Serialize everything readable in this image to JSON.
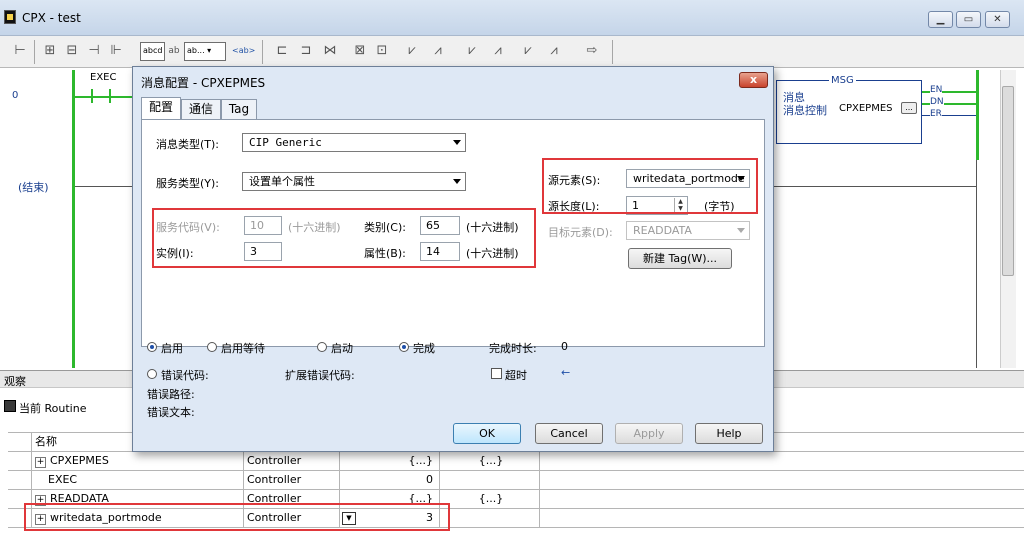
{
  "window": {
    "title": "CPX - test"
  },
  "toolbar": {
    "format_box_1": "abcd",
    "format_box_2": "ab...",
    "format_box_3": "<ab>"
  },
  "ladder": {
    "rung_number": "0",
    "end_label": "(结束)",
    "exec_label": "EXEC",
    "msg_block": {
      "header": "MSG",
      "line1": "消息",
      "line2": "消息控制",
      "control_tag": "CPXEPMES",
      "ellipsis": "...",
      "outputs": [
        "EN",
        "DN",
        "ER"
      ]
    }
  },
  "dialog": {
    "title": "消息配置 - CPXEPMES",
    "close": "x",
    "tabs": [
      "配置",
      "通信",
      "Tag"
    ],
    "message_type_label": "消息类型(T):",
    "message_type_value": "CIP Generic",
    "service_type_label": "服务类型(Y):",
    "service_type_value": "设置单个属性",
    "service_code_label": "服务代码(V):",
    "service_code_value": "10",
    "hex_unit": "(十六进制)",
    "class_label": "类别(C):",
    "class_value": "65",
    "class_unit": "(十六进制)",
    "instance_label": "实例(I):",
    "instance_value": "3",
    "attribute_label": "属性(B):",
    "attribute_value": "14",
    "attribute_unit": "(十六进制)",
    "source_element_label": "源元素(S):",
    "source_element_value": "writedata_portmode",
    "source_length_label": "源长度(L):",
    "source_length_value": "1",
    "source_length_unit": "(字节)",
    "dest_element_label": "目标元素(D):",
    "dest_element_value": "READDATA",
    "new_tag_button": "新建 Tag(W)...",
    "status": {
      "enable": "启用",
      "enable_wait": "启用等待",
      "start": "启动",
      "done": "完成",
      "done_length_label": "完成时长:",
      "done_length_value": "0",
      "error_code_label": "错误代码:",
      "ext_error_code_label": "扩展错误代码:",
      "timeout_label": "超时",
      "error_path_label": "错误路径:",
      "error_text_label": "错误文本:"
    },
    "buttons": {
      "ok": "OK",
      "cancel": "Cancel",
      "apply": "Apply",
      "help": "Help"
    }
  },
  "watch": {
    "pane_title": "观察",
    "scope": "当前 Routine",
    "column_name": "名称",
    "rows": [
      {
        "name": "CPXEPMES",
        "scope": "Controller",
        "value": "{...}",
        "force": "{...}",
        "expand": "+"
      },
      {
        "name": "EXEC",
        "scope": "Controller",
        "value": "0",
        "force": "",
        "expand": ""
      },
      {
        "name": "READDATA",
        "scope": "Controller",
        "value": "{...}",
        "force": "{...}",
        "expand": "+"
      },
      {
        "name": "writedata_portmode",
        "scope": "Controller",
        "value": "3",
        "force": "",
        "expand": "+"
      }
    ]
  }
}
